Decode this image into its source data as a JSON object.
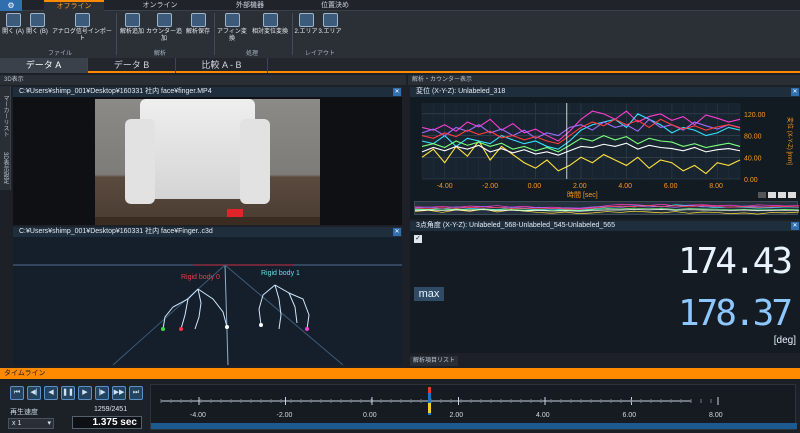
{
  "ribbon": {
    "tabs": [
      "オフライン",
      "オンライン",
      "外部機器",
      "位置決め"
    ],
    "tools": [
      {
        "label": "開く\n(A)",
        "icon": "folder-open-icon"
      },
      {
        "label": "開く\n(B)",
        "icon": "folder-open-icon"
      },
      {
        "label": "アナログ信号インポート",
        "icon": "import-arrow-icon"
      },
      {
        "label": "解析追加",
        "icon": "analysis-add-icon"
      },
      {
        "label": "カウンター追加",
        "icon": "counter-add-icon"
      },
      {
        "label": "解析保存",
        "icon": "save-icon"
      },
      {
        "label": "アフィン変換",
        "icon": "affine-icon"
      },
      {
        "label": "相対変位変換",
        "icon": "relative-disp-icon"
      },
      {
        "label": "2.エリア",
        "icon": "layout-2-icon"
      },
      {
        "label": "3.エリア",
        "icon": "layout-3-icon"
      }
    ],
    "groups": [
      "ファイル",
      "解析",
      "処理",
      "レイアウト"
    ]
  },
  "data_tabs": [
    "データ A",
    "データ B",
    "比較 A - B"
  ],
  "left": {
    "header": "3D表示",
    "side_tabs": [
      "マーカーリスト",
      "3D表示設定"
    ],
    "video_path": "C:¥Users¥shimp_001¥Desktop¥160331 社内 face¥finger.MP4",
    "c3d_path": "C:¥Users¥shimp_001¥Desktop¥160331 社内 face¥Finger..c3d",
    "rigid0": "Rigid body 0",
    "rigid1": "Rigid body 1"
  },
  "right": {
    "header": "解析・カウンター表示",
    "chart_title": "変位 (X-Y-Z):  Unlabeled_318",
    "ylabel": "変位 (X-Y-Z) [mm]",
    "xlabel": "時間 [sec]",
    "angle_title": "3点角度 (X-Y-Z):  Unlabeled_568-Unlabeled_545-Unlabeled_565",
    "value_current": "174.43",
    "max_label": "max",
    "value_max": "178.37",
    "unit": "[deg]",
    "list_tab": "解析項目リスト"
  },
  "timeline": {
    "title": "タイムライン",
    "speed_label": "再生速度",
    "speed_value": "x 1",
    "frame": "1259/2451",
    "time": "1.375 sec",
    "ticks": [
      "-4.00",
      "-2.00",
      "0.00",
      "2.00",
      "4.00",
      "6.00",
      "8.00"
    ]
  },
  "chart_data": {
    "type": "line",
    "xlabel": "時間 [sec]",
    "ylabel": "変位 (X-Y-Z) [mm]",
    "xlim": [
      -5,
      9
    ],
    "ylim": [
      0,
      140
    ],
    "x_ticks": [
      -4,
      -2,
      0,
      2,
      4,
      6,
      8
    ],
    "y_ticks": [
      0,
      40,
      80,
      120
    ],
    "x": [
      -5,
      -4.5,
      -4,
      -3.5,
      -3,
      -2.5,
      -2,
      -1.5,
      -1,
      -0.5,
      0,
      0.5,
      1,
      1.5,
      2,
      2.5,
      3,
      3.5,
      4,
      4.5,
      5,
      5.5,
      6,
      6.5,
      7,
      7.5,
      8,
      8.5,
      9
    ],
    "series": [
      {
        "color": "#ff3bd0",
        "values": [
          95,
          90,
          100,
          88,
          105,
          96,
          110,
          90,
          102,
          85,
          92,
          80,
          70,
          88,
          110,
          125,
          120,
          110,
          125,
          105,
          115,
          120,
          108,
          115,
          100,
          118,
          112,
          105,
          110
        ]
      },
      {
        "color": "#ffe23a",
        "values": [
          40,
          55,
          30,
          60,
          42,
          70,
          35,
          60,
          45,
          30,
          20,
          35,
          15,
          25,
          40,
          30,
          45,
          35,
          25,
          40,
          20,
          35,
          30,
          15,
          25,
          10,
          30,
          25,
          35
        ]
      },
      {
        "color": "#35e3ff",
        "values": [
          70,
          65,
          80,
          60,
          75,
          70,
          65,
          80,
          72,
          65,
          70,
          60,
          55,
          70,
          90,
          100,
          105,
          110,
          95,
          120,
          110,
          100,
          85,
          95,
          90,
          80,
          85,
          95,
          90
        ]
      },
      {
        "color": "#a06bff",
        "values": [
          85,
          92,
          80,
          95,
          88,
          100,
          85,
          92,
          80,
          90,
          75,
          85,
          80,
          95,
          100,
          90,
          105,
          95,
          100,
          88,
          110,
          95,
          100,
          90,
          105,
          98,
          92,
          100,
          95
        ]
      },
      {
        "color": "#ff3b3b",
        "values": [
          80,
          75,
          85,
          78,
          90,
          82,
          88,
          76,
          80,
          72,
          78,
          70,
          65,
          80,
          95,
          105,
          98,
          110,
          100,
          108,
          95,
          110,
          100,
          92,
          98,
          90,
          96,
          100,
          94
        ]
      },
      {
        "color": "#7aff7a",
        "values": [
          60,
          65,
          58,
          70,
          62,
          68,
          60,
          66,
          55,
          60,
          52,
          58,
          50,
          62,
          75,
          70,
          80,
          72,
          78,
          65,
          75,
          70,
          68,
          60,
          65,
          58,
          62,
          66,
          60
        ]
      },
      {
        "color": "#ffffff",
        "values": [
          50,
          58,
          52,
          60,
          55,
          62,
          50,
          56,
          48,
          54,
          46,
          50,
          44,
          52,
          60,
          58,
          64,
          60,
          66,
          55,
          62,
          58,
          56,
          52,
          58,
          50,
          54,
          56,
          52
        ]
      }
    ]
  },
  "colors": {
    "accent": "#ff8a00",
    "value": "#8ec7ff",
    "brand": "#2f6fb0"
  }
}
